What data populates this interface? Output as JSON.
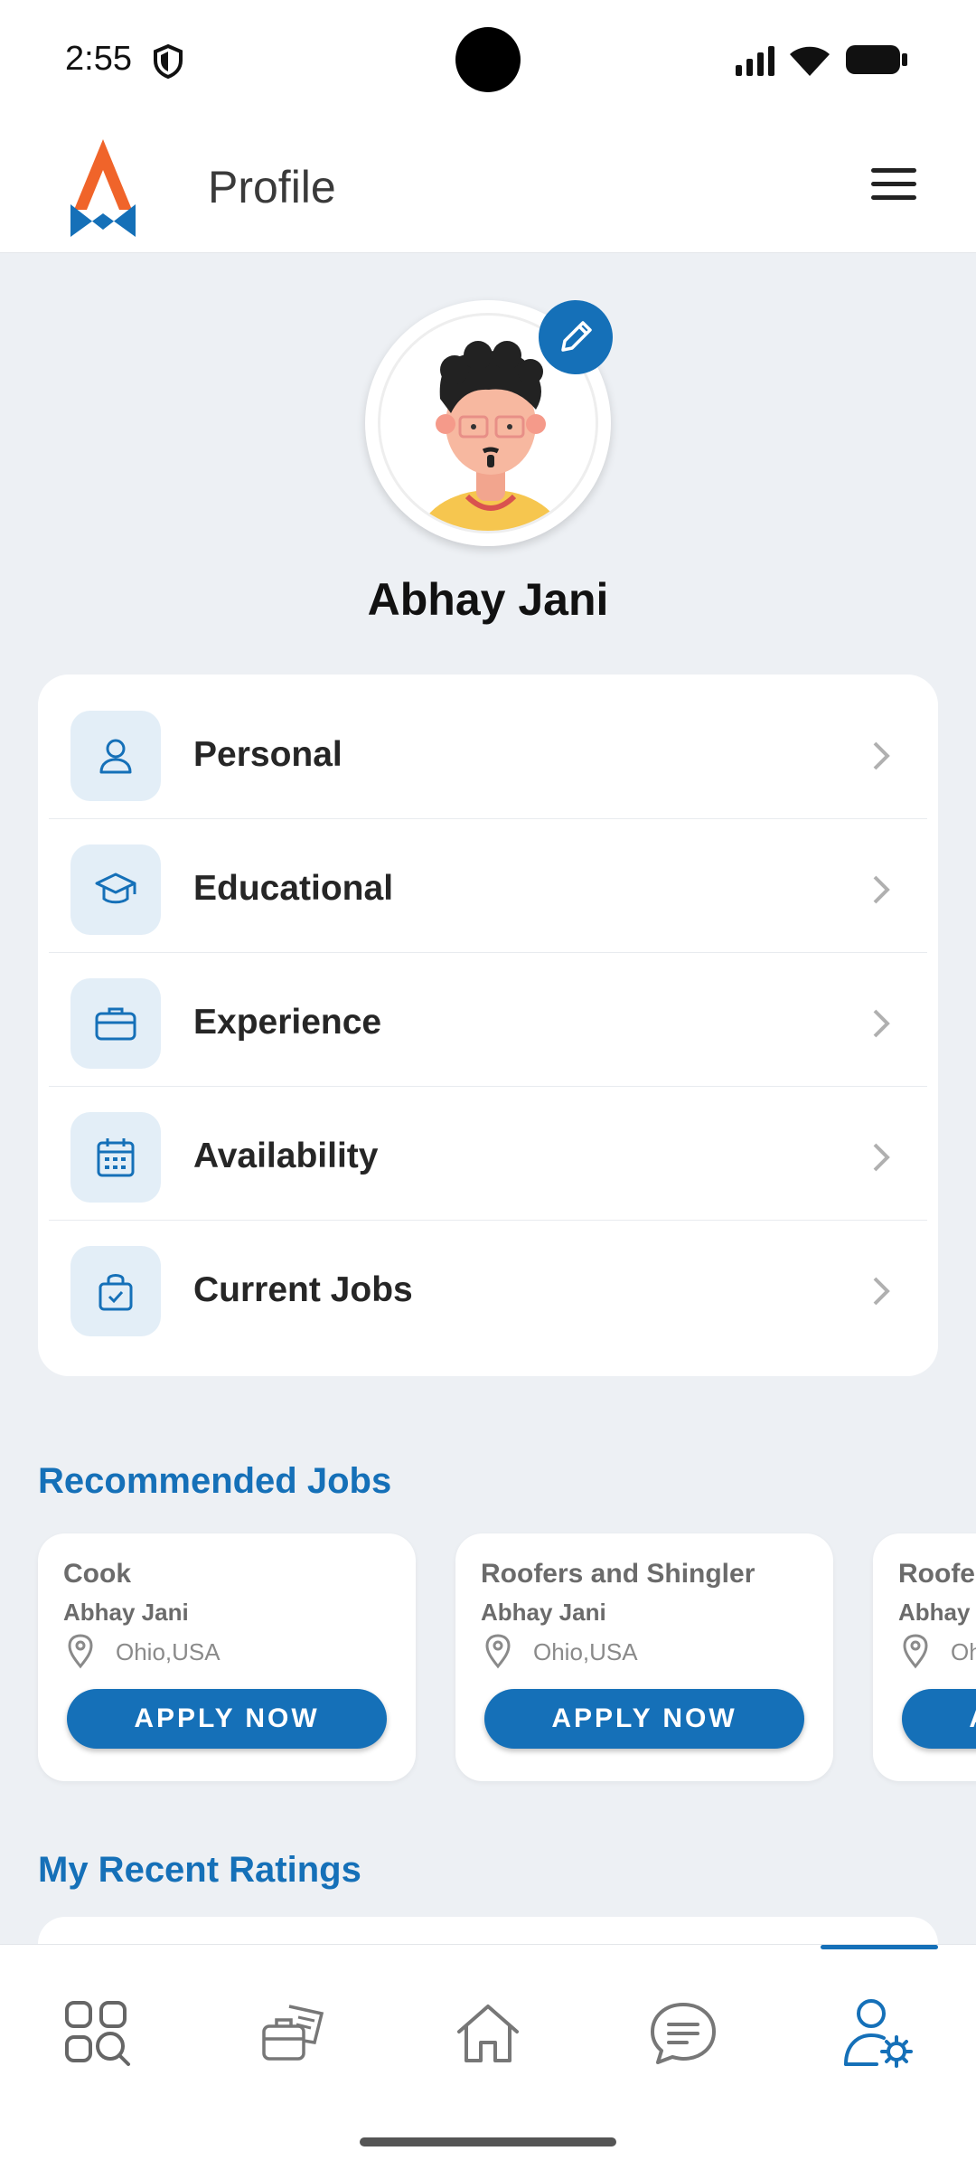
{
  "status_bar": {
    "time": "2:55"
  },
  "header": {
    "title": "Profile"
  },
  "profile": {
    "name": "Abhay Jani"
  },
  "menu": {
    "items": [
      {
        "label": "Personal",
        "icon": "person-icon"
      },
      {
        "label": "Educational",
        "icon": "graduation-cap-icon"
      },
      {
        "label": "Experience",
        "icon": "briefcase-icon"
      },
      {
        "label": "Availability",
        "icon": "calendar-icon"
      },
      {
        "label": "Current Jobs",
        "icon": "shopping-bag-check-icon"
      }
    ]
  },
  "recommended": {
    "title": "Recommended Jobs",
    "jobs": [
      {
        "title": "Cook",
        "company": "Abhay Jani",
        "location": "Ohio,USA",
        "button": "APPLY NOW"
      },
      {
        "title": "Roofers and Shingler",
        "company": "Abhay Jani",
        "location": "Ohio,USA",
        "button": "APPLY NOW"
      },
      {
        "title": "Roofers and Shingler",
        "company": "Abhay Jani",
        "location": "Ohio,USA",
        "button": "APPLY NOW"
      }
    ]
  },
  "ratings": {
    "title": "My Recent Ratings"
  },
  "bottom_nav": {
    "items": [
      "search-jobs-icon",
      "job-briefcase-icon",
      "home-icon",
      "chat-icon",
      "profile-settings-icon"
    ],
    "active": "profile-settings-icon"
  },
  "colors": {
    "accent": "#1570b8",
    "background": "#edf0f4",
    "logo_orange": "#f0642a"
  }
}
